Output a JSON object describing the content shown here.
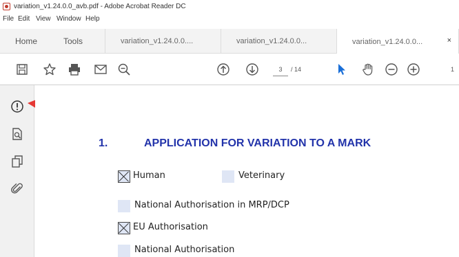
{
  "window": {
    "title": "variation_v1.24.0.0_avb.pdf - Adobe Acrobat Reader DC"
  },
  "menu": [
    "File",
    "Edit",
    "View",
    "Window",
    "Help"
  ],
  "tabs": {
    "home": "Home",
    "tools": "Tools",
    "documents": [
      "variation_v1.24.0.0....",
      "variation_v1.24.0.0...",
      "variation_v1.24.0.0..."
    ],
    "close_glyph": "×"
  },
  "toolbar": {
    "icons": [
      "save-icon",
      "bookmark-star-icon",
      "print-icon",
      "email-icon",
      "search-zoom-icon",
      "prev-page-icon",
      "next-page-icon",
      "select-cursor-icon",
      "hand-tool-icon",
      "zoom-out-icon",
      "zoom-in-icon"
    ],
    "current_page": "3",
    "page_total": "/ 14",
    "zoom_partial": "1"
  },
  "sidebar": {
    "icons": [
      "alert-circle-icon",
      "document-search-icon",
      "copy-pages-icon",
      "attachment-icon"
    ]
  },
  "document": {
    "section_number": "1.",
    "section_title": "APPLICATION FOR VARIATION TO A MARK",
    "options": [
      {
        "label": "Human",
        "checked": true
      },
      {
        "label": "Veterinary",
        "checked": false
      },
      {
        "label": "National Authorisation in MRP/DCP",
        "checked": false
      },
      {
        "label": "EU Authorisation",
        "checked": true
      },
      {
        "label": "National Authorisation",
        "checked": false
      }
    ]
  },
  "colors": {
    "heading": "#2233aa",
    "checkbox_fill": "#dfe6f5",
    "arrow": "#e53935",
    "select_tool": "#1a6fd8"
  }
}
